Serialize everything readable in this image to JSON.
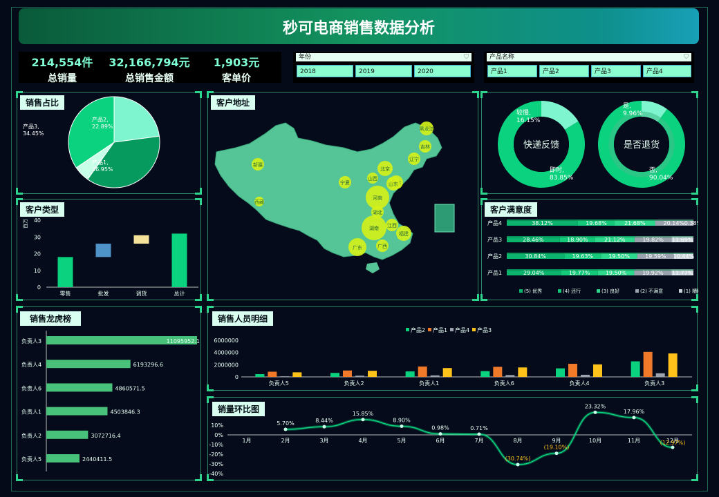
{
  "title": "秒可电商销售数据分析",
  "colors": {
    "accent": "#2dd48c",
    "g1": "#0bd27f",
    "g2": "#079a5e",
    "g3": "#7ff5cf",
    "g4": "#c8ffe9",
    "orange": "#f07a2a",
    "gray": "#9aa3ad",
    "yellow": "#ffc21a",
    "bubble": "#d4f01a",
    "map": "#55c597"
  },
  "kpis": [
    {
      "value": "214,554件",
      "label": "总销量"
    },
    {
      "value": "32,166,794元",
      "label": "总销售金额"
    },
    {
      "value": "1,903元",
      "label": "客单价"
    }
  ],
  "slicer_year": {
    "label": "年份",
    "options": [
      "2018",
      "2019",
      "2020"
    ]
  },
  "slicer_product": {
    "label": "产品名称",
    "options": [
      "产品1",
      "产品2",
      "产品3",
      "产品4"
    ]
  },
  "panels": {
    "share": "销售占比",
    "address": "客户地址",
    "ctype": "客户类型",
    "satisfaction": "客户满意度",
    "ranking": "销售龙虎榜",
    "staff": "销售人员明细",
    "mom": "销量环比图"
  },
  "chart_data": [
    {
      "id": "share",
      "type": "pie",
      "labels": [
        "产品2",
        "产品1",
        "产品4",
        "产品3"
      ],
      "values": [
        22.89,
        36.95,
        5.71,
        34.45
      ],
      "display": [
        "22.89%",
        "36.95%",
        "5.71%",
        "34.45%"
      ]
    },
    {
      "id": "delivery",
      "type": "pie",
      "title": "快递反馈",
      "labels": [
        "较慢",
        "即时"
      ],
      "values": [
        16.15,
        83.85
      ],
      "display": [
        "16.15%",
        "83.85%"
      ]
    },
    {
      "id": "return",
      "type": "pie",
      "title": "是否退货",
      "labels": [
        "是",
        "否"
      ],
      "values": [
        9.96,
        90.04
      ],
      "display": [
        "9.96%",
        "90.04%"
      ]
    },
    {
      "id": "ctype",
      "type": "bar",
      "categories": [
        "零售",
        "批发",
        "调货",
        "总计"
      ],
      "ranges": [
        [
          0,
          18
        ],
        [
          18,
          26
        ],
        [
          26,
          31
        ],
        [
          0,
          32
        ]
      ],
      "ylim": [
        0,
        40
      ],
      "yticks": [
        "0",
        "10",
        "20",
        "30",
        "40"
      ],
      "ylabel": "百万"
    },
    {
      "id": "satisfaction",
      "type": "bar",
      "categories": [
        "产品4",
        "产品3",
        "产品2",
        "产品1"
      ],
      "series": [
        {
          "name": "(5) 优秀",
          "values": [
            38.12,
            28.46,
            30.84,
            29.04
          ]
        },
        {
          "name": "(4) 还行",
          "values": [
            19.68,
            18.9,
            19.63,
            19.77
          ]
        },
        {
          "name": "(3) 良好",
          "values": [
            21.68,
            21.12,
            19.5,
            19.5
          ]
        },
        {
          "name": "(2) 不满意",
          "values": [
            20.14,
            19.82,
            19.59,
            19.92
          ]
        },
        {
          "name": "(1) 糟糕",
          "values": [
            0.38,
            11.69,
            10.44,
            11.77
          ]
        }
      ],
      "display_labels": [
        [
          "38.12%",
          "19.68%",
          "21.68%",
          "20.14%",
          "0.38%"
        ],
        [
          "28.46%",
          "18.90%",
          "21.12%",
          "19.82%",
          "11.69%"
        ],
        [
          "30.84%",
          "19.63%",
          "19.50%",
          "19.59%",
          "10.44%"
        ],
        [
          "29.04%",
          "19.77%",
          "19.50%",
          "19.92%",
          "11.77%"
        ]
      ]
    },
    {
      "id": "ranking",
      "type": "bar",
      "categories": [
        "负责人3",
        "负责人4",
        "负责人6",
        "负责人1",
        "负责人2",
        "负责人5"
      ],
      "values": [
        11095952.1,
        6193296.6,
        4860571.5,
        4503846.3,
        3072716.4,
        2440411.5
      ],
      "display": [
        "11095952.1",
        "6193296.6",
        "4860571.5",
        "4503846.3",
        "3072716.4",
        "2440411.5"
      ]
    },
    {
      "id": "staff",
      "type": "bar",
      "categories": [
        "负责人5",
        "负责人2",
        "负责人1",
        "负责人6",
        "负责人4",
        "负责人3"
      ],
      "series": [
        {
          "name": "产品2",
          "values": [
            450000,
            650000,
            900000,
            950000,
            1400000,
            2550000
          ]
        },
        {
          "name": "产品1",
          "values": [
            850000,
            1050000,
            1700000,
            1650000,
            2150000,
            4100000
          ]
        },
        {
          "name": "产品4",
          "values": [
            100000,
            200000,
            250000,
            300000,
            350000,
            600000
          ]
        },
        {
          "name": "产品3",
          "values": [
            750000,
            1000000,
            1450000,
            1550000,
            2050000,
            3850000
          ]
        }
      ],
      "ylim": [
        0,
        6000000
      ],
      "yticks": [
        "0",
        "2000000",
        "4000000",
        "6000000"
      ]
    },
    {
      "id": "mom",
      "type": "line",
      "categories": [
        "1月",
        "2月",
        "3月",
        "4月",
        "5月",
        "6月",
        "7月",
        "8月",
        "9月",
        "10月",
        "11月",
        "12月"
      ],
      "values": [
        null,
        5.7,
        8.44,
        15.85,
        8.9,
        0.98,
        0.71,
        -30.74,
        -19.1,
        23.32,
        17.96,
        -12.97
      ],
      "display": [
        "",
        "5.70%",
        "8.44%",
        "15.85%",
        "8.90%",
        "0.98%",
        "0.71%",
        "(30.74%)",
        "(19.10%)",
        "23.32%",
        "17.96%",
        "(12.97%)"
      ],
      "ylim": [
        -40,
        10
      ],
      "yticks": [
        "10%",
        "0%",
        "-10%",
        "-20%",
        "-30%",
        "-40%"
      ]
    }
  ],
  "map_bubbles": [
    "黑龙江",
    "吉林",
    "辽宁",
    "北京",
    "天津",
    "山东",
    "山西",
    "河南",
    "宁夏",
    "新疆",
    "湖北",
    "湖南",
    "江西",
    "福建",
    "广东",
    "广西",
    "西藏"
  ]
}
